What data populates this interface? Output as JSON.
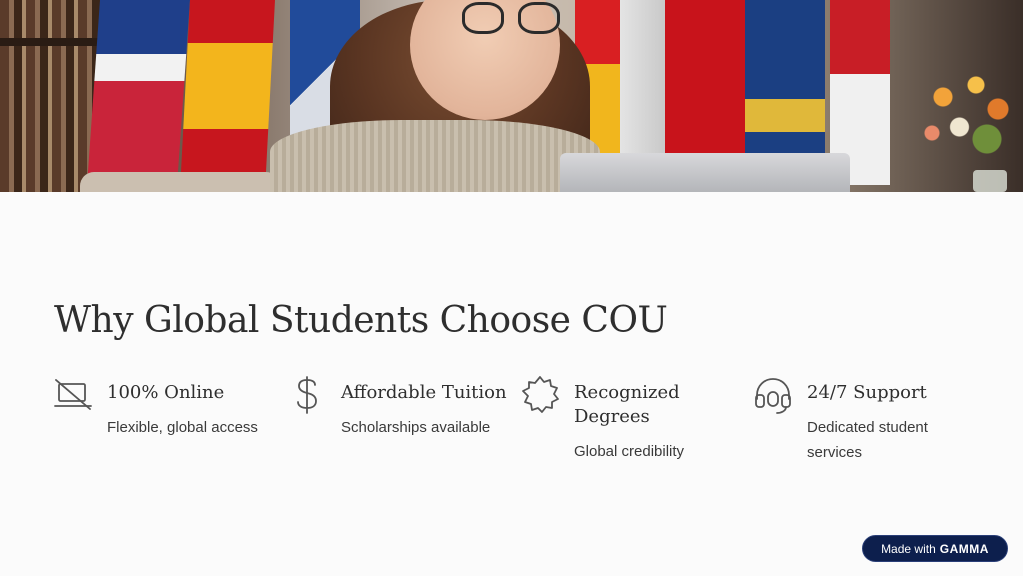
{
  "hero": {
    "image_semantic": "hero-photo-student-with-laptop-and-flags"
  },
  "heading": {
    "title": "Why Global Students Choose COU"
  },
  "features": [
    {
      "icon": "laptop-off-icon",
      "title": "100% Online",
      "description": "Flexible, global access"
    },
    {
      "icon": "dollar-sign-icon",
      "title": "Affordable Tuition",
      "description": "Scholarships available"
    },
    {
      "icon": "badge-icon",
      "title": "Recognized Degrees",
      "description": "Global credibility"
    },
    {
      "icon": "headset-icon",
      "title": "24/7 Support",
      "description": "Dedicated student services"
    }
  ],
  "badge": {
    "prefix": "Made with",
    "brand": "GAMMA"
  },
  "colors": {
    "background": "#fbfbfb",
    "text": "#2e2e2e",
    "icon": "#555555",
    "badge_bg": "#0d1f4d"
  }
}
